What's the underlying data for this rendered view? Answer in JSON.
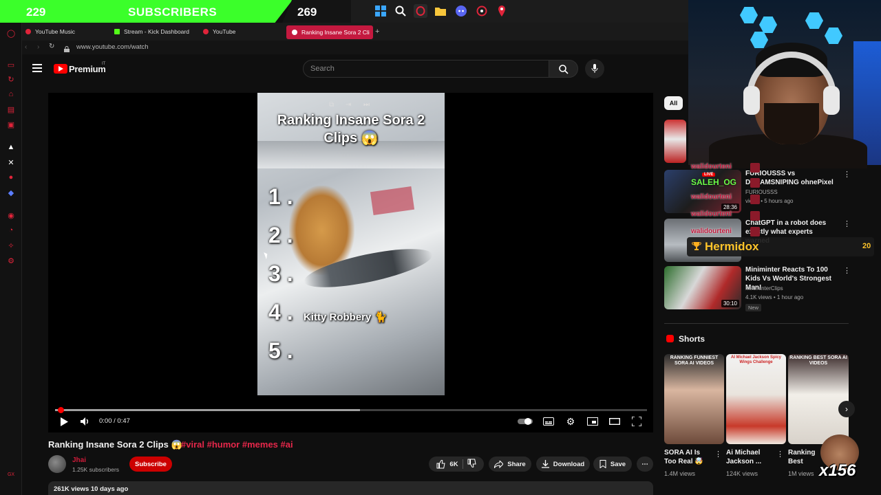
{
  "overlay": {
    "subscribers_count": "229",
    "subscribers_label": "SUBSCRIBERS",
    "goal_count": "269",
    "leader_name": "Hermidox",
    "leader_count": "20",
    "reaction_count": "x156",
    "chat": {
      "username": "walidourteni",
      "line1": "SALEH_OG",
      "live_label": "LIVE"
    }
  },
  "taskbar": {
    "icons": [
      "windows-icon",
      "search-icon",
      "opera-icon",
      "file-explorer-icon",
      "discord-icon",
      "app-icon",
      "maps-pin-icon"
    ]
  },
  "browser": {
    "tabs": [
      {
        "label": "YouTube Music",
        "color": "#e0243a"
      },
      {
        "label": "Stream - Kick Dashboard",
        "color": "#53fc18"
      },
      {
        "label": "YouTube",
        "color": "#e0243a"
      }
    ],
    "active_tab": "Ranking Insane Sora 2 Cli",
    "url": "www.youtube.com/watch"
  },
  "youtube": {
    "brand": "Premium",
    "region": "IT",
    "search_placeholder": "Search",
    "video": {
      "overlay_title": "Ranking Insane Sora 2 Clips 😱",
      "ranks": [
        "1 .",
        "2 .",
        "3 .",
        "4 .",
        "5 ."
      ],
      "rank4_label": "Kitty Robbery 🐈",
      "time": "0:00 / 0:47",
      "progress_fraction": 0.005,
      "buffered_fraction": 0.515
    },
    "title": "Ranking Insane Sora 2 Clips 😱",
    "tags": "#viral #humor #memes #ai",
    "channel": {
      "name": "Jhai",
      "subscribers": "1.25K subscribers"
    },
    "subscribe_label": "Subscribe",
    "like_count": "6K",
    "share_label": "Share",
    "download_label": "Download",
    "save_label": "Save",
    "views_line": "261K views  10 days ago",
    "chip_all": "All",
    "recommendations": [
      {
        "title": "FURIOUSSS vs DREAMSNIPING ohnePixel",
        "channel": "FURIOUSSS",
        "meta": "views • 5 hours ago",
        "duration": "28:36"
      },
      {
        "title": "ChatGPT in a robot does exactly what experts warned",
        "channel": "",
        "meta": "",
        "duration": ""
      },
      {
        "title": "Miniminter Reacts To 100 Kids Vs World's Strongest Man!",
        "channel": "MiniminterClips",
        "meta": "4.1K views • 1 hour ago",
        "duration": "30:10",
        "badge": "New"
      }
    ],
    "shorts_label": "Shorts",
    "shorts": [
      {
        "title": "SORA AI Is Too Real 🤯",
        "views": "1.4M views",
        "caption": "RANKING FUNNIEST SORA AI VIDEOS"
      },
      {
        "title": "Ai Michael Jackson ...",
        "views": "124K views",
        "caption": "AI Michael Jackson Spicy Wings Challenge"
      },
      {
        "title": "Ranking Best SORA 2 AI",
        "views": "1M views",
        "caption": "RANKING BEST SORA AI VIDEOS"
      }
    ]
  }
}
